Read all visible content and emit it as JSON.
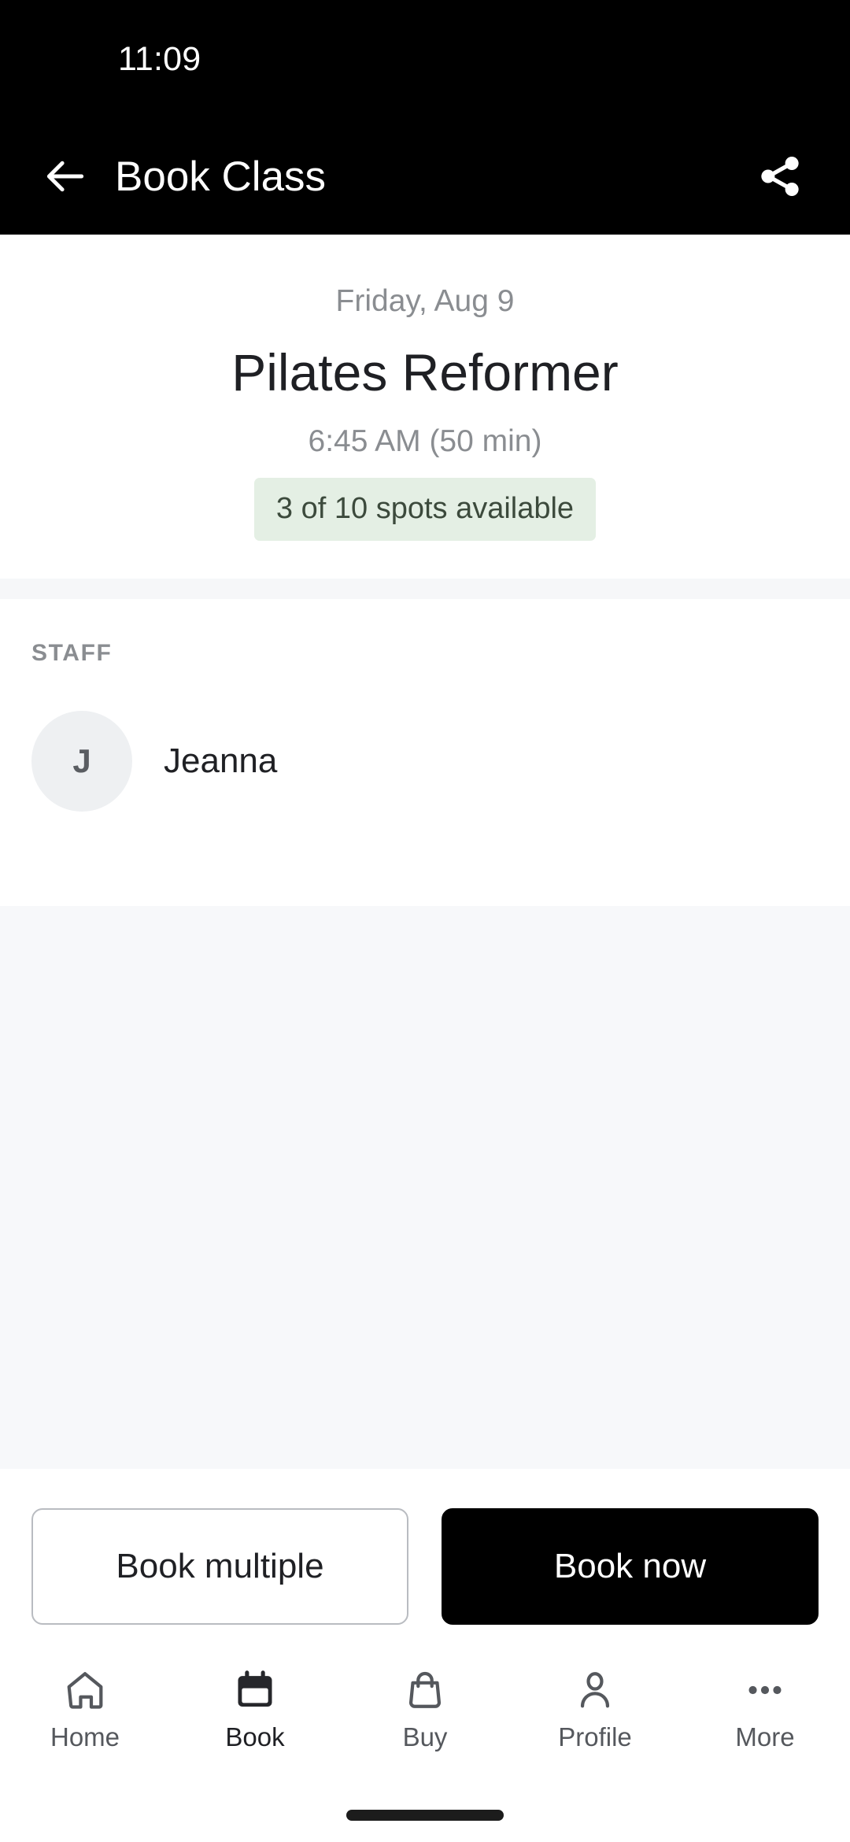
{
  "status_bar": {
    "time": "11:09"
  },
  "app_bar": {
    "title": "Book Class",
    "back_icon": "arrow-left-icon",
    "share_icon": "share-icon"
  },
  "class": {
    "date": "Friday, Aug 9",
    "name": "Pilates Reformer",
    "time": "6:45 AM (50 min)",
    "spots": "3 of 10 spots available",
    "spots_bg": "#e4efe4",
    "spots_color": "#3c4a3c"
  },
  "staff": {
    "section_label": "STAFF",
    "members": [
      {
        "initial": "J",
        "name": "Jeanna"
      }
    ]
  },
  "actions": {
    "secondary_label": "Book multiple",
    "primary_label": "Book now"
  },
  "bottom_nav": {
    "items": [
      {
        "label": "Home",
        "icon": "home-icon",
        "active": false
      },
      {
        "label": "Book",
        "icon": "calendar-icon",
        "active": true
      },
      {
        "label": "Buy",
        "icon": "bag-icon",
        "active": false
      },
      {
        "label": "Profile",
        "icon": "person-icon",
        "active": false
      },
      {
        "label": "More",
        "icon": "dots-icon",
        "active": false
      }
    ]
  }
}
